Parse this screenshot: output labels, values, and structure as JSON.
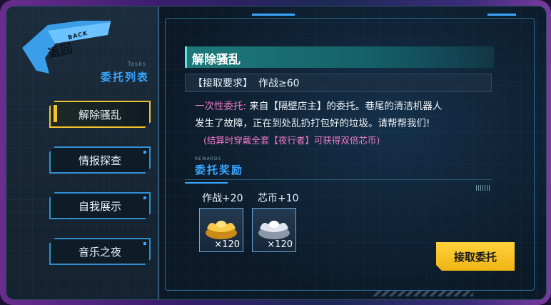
{
  "back": {
    "label": "返回",
    "en_label": "BACK"
  },
  "sidebar": {
    "subtitle": "Tasks",
    "title": "委托列表",
    "items": [
      {
        "label": "解除骚乱",
        "active": true
      },
      {
        "label": "情报探查",
        "active": false
      },
      {
        "label": "自我展示",
        "active": false
      },
      {
        "label": "音乐之夜",
        "active": false
      }
    ]
  },
  "task": {
    "title": "解除骚乱",
    "requirement_label": "【接取要求】",
    "requirement_value": "作战≥60",
    "description": {
      "type_label": "一次性委托:",
      "line1": "来自【隔壁店主】的委托。巷尾的清洁机器人",
      "line2": "发生了故障，正在到处乱扔打包好的垃圾。请帮帮我们!",
      "note": "(结算时穿戴全套【夜行者】可获得双倍芯币)"
    }
  },
  "rewards": {
    "en_label": "REWARDS",
    "title": "委托奖励",
    "labels": [
      "作战+20",
      "芯币+10"
    ],
    "items": [
      {
        "icon": "gold-ingot-icon",
        "qty": "×120"
      },
      {
        "icon": "silver-ingot-icon",
        "qty": "×120"
      }
    ]
  },
  "accept_button": {
    "label": "接取委托"
  },
  "colors": {
    "accent_blue": "#3aa6ff",
    "accent_yellow": "#f2c230",
    "pink_text": "#f07ac8"
  }
}
